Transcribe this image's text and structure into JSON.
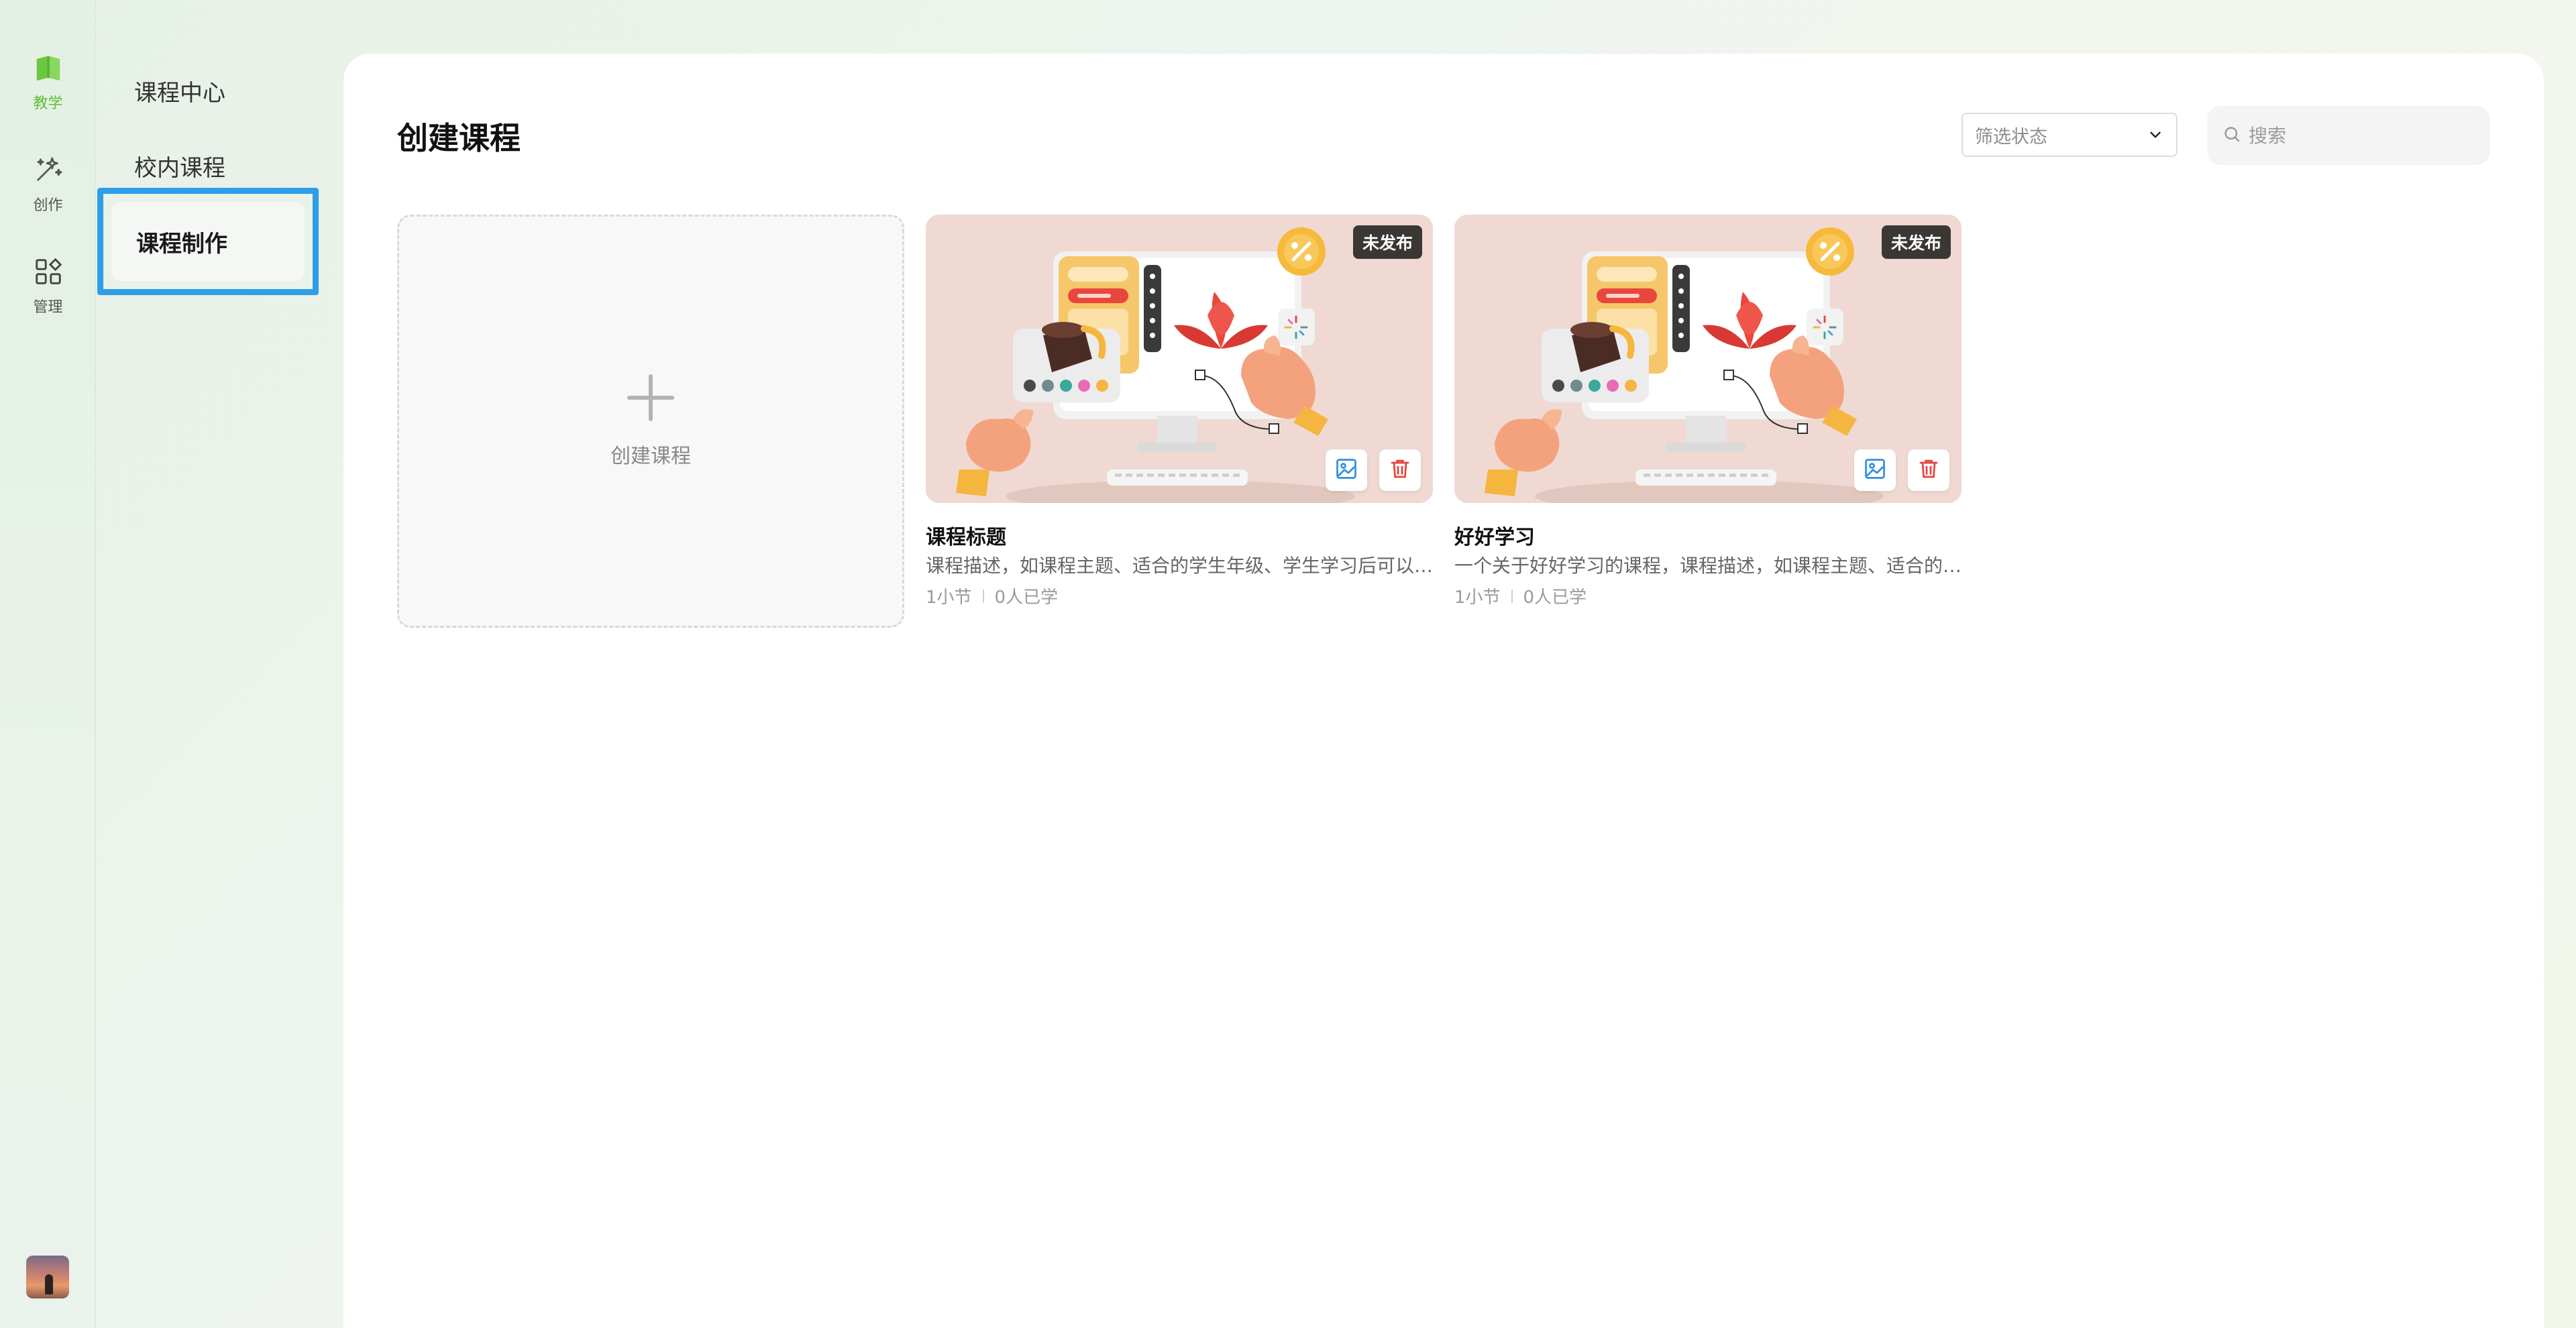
{
  "rail": {
    "items": [
      {
        "label": "教学",
        "icon": "book-icon",
        "active": true
      },
      {
        "label": "创作",
        "icon": "magic-wand-icon",
        "active": false
      },
      {
        "label": "管理",
        "icon": "apps-grid-icon",
        "active": false
      }
    ],
    "accent_color": "#5cbf3a"
  },
  "subnav": {
    "items": [
      {
        "label": "课程中心"
      },
      {
        "label": "校内课程"
      },
      {
        "label": "课程制作",
        "selected": true
      }
    ],
    "highlight_color": "#2f9ee9"
  },
  "main": {
    "title": "创建课程",
    "filter": {
      "placeholder": "筛选状态"
    },
    "search": {
      "placeholder": "搜索"
    },
    "create_card": {
      "label": "创建课程"
    },
    "courses": [
      {
        "badge": "未发布",
        "title": "课程标题",
        "description": "课程描述，如课程主题、适合的学生年级、学生学习后可以…",
        "lessons": "1小节",
        "learners": "0人已学"
      },
      {
        "badge": "未发布",
        "title": "好好学习",
        "description": "一个关于好好学习的课程，课程描述，如课程主题、适合的…",
        "lessons": "1小节",
        "learners": "0人已学"
      }
    ]
  }
}
